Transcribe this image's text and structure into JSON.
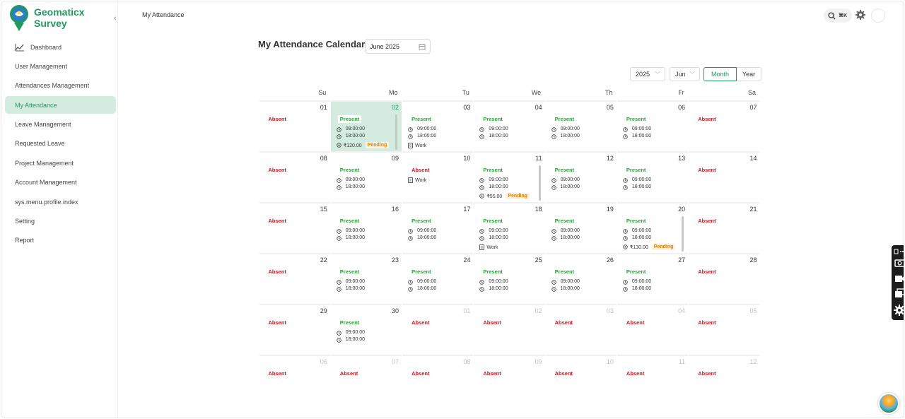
{
  "app": {
    "name": "Geomaticx Survey",
    "accent": "#1e9a5f"
  },
  "sidebar": {
    "items": [
      {
        "label": "Dashboard",
        "icon": "chart-icon"
      },
      {
        "label": "User Management"
      },
      {
        "label": "Attendances Management"
      },
      {
        "label": "My Attendance",
        "active": true
      },
      {
        "label": "Leave Management"
      },
      {
        "label": "Requested Leave"
      },
      {
        "label": "Project Management"
      },
      {
        "label": "Account Management"
      },
      {
        "label": "sys.menu.profile.index"
      },
      {
        "label": "Setting"
      },
      {
        "label": "Report"
      }
    ]
  },
  "header": {
    "breadcrumb": "My Attendance",
    "search_shortcut": "⌘K"
  },
  "page": {
    "title": "My Attendance Calendar",
    "month_value": "June 2025",
    "year_select": "2025",
    "month_select": "Jun",
    "view_month": "Month",
    "view_year": "Year"
  },
  "calendar": {
    "weekdays": [
      "Su",
      "Mo",
      "Tu",
      "We",
      "Th",
      "Fr",
      "Sa"
    ],
    "labels": {
      "absent": "Absent",
      "present": "Present",
      "check_in": "09:00:00",
      "check_out": "18:00:00",
      "work": "Work",
      "pending": "Pending"
    },
    "weeks": [
      [
        {
          "d": "01",
          "s": "absent"
        },
        {
          "d": "02",
          "s": "present",
          "today": true,
          "amount": "₹120.00",
          "pending": true,
          "scroll": true
        },
        {
          "d": "03",
          "s": "present",
          "work": true
        },
        {
          "d": "04",
          "s": "present"
        },
        {
          "d": "05",
          "s": "present"
        },
        {
          "d": "06",
          "s": "present"
        },
        {
          "d": "07",
          "s": "absent"
        }
      ],
      [
        {
          "d": "08",
          "s": "absent"
        },
        {
          "d": "09",
          "s": "present"
        },
        {
          "d": "10",
          "s": "absent",
          "work_only": true
        },
        {
          "d": "11",
          "s": "present",
          "amount": "₹55.00",
          "pending": true,
          "scroll": true
        },
        {
          "d": "12",
          "s": "present"
        },
        {
          "d": "13",
          "s": "present"
        },
        {
          "d": "14",
          "s": "absent"
        }
      ],
      [
        {
          "d": "15",
          "s": "absent"
        },
        {
          "d": "16",
          "s": "present"
        },
        {
          "d": "17",
          "s": "present"
        },
        {
          "d": "18",
          "s": "present",
          "work": true
        },
        {
          "d": "19",
          "s": "present"
        },
        {
          "d": "20",
          "s": "present",
          "amount": "₹130.00",
          "pending": true,
          "scroll": true
        },
        {
          "d": "21",
          "s": "absent"
        }
      ],
      [
        {
          "d": "22",
          "s": "absent"
        },
        {
          "d": "23",
          "s": "present"
        },
        {
          "d": "24",
          "s": "present"
        },
        {
          "d": "25",
          "s": "present"
        },
        {
          "d": "26",
          "s": "present"
        },
        {
          "d": "27",
          "s": "present"
        },
        {
          "d": "28",
          "s": "absent"
        }
      ],
      [
        {
          "d": "29",
          "s": "absent"
        },
        {
          "d": "30",
          "s": "present"
        },
        {
          "d": "01",
          "s": "absent",
          "other": true
        },
        {
          "d": "02",
          "s": "absent",
          "other": true
        },
        {
          "d": "03",
          "s": "absent",
          "other": true
        },
        {
          "d": "04",
          "s": "absent",
          "other": true
        },
        {
          "d": "05",
          "s": "absent",
          "other": true
        }
      ],
      [
        {
          "d": "06",
          "s": "absent",
          "other": true
        },
        {
          "d": "07",
          "s": "absent",
          "other": true
        },
        {
          "d": "08",
          "s": "absent",
          "other": true
        },
        {
          "d": "09",
          "s": "absent",
          "other": true
        },
        {
          "d": "10",
          "s": "absent",
          "other": true
        },
        {
          "d": "11",
          "s": "absent",
          "other": true
        },
        {
          "d": "12",
          "s": "absent",
          "other": true
        }
      ]
    ]
  }
}
